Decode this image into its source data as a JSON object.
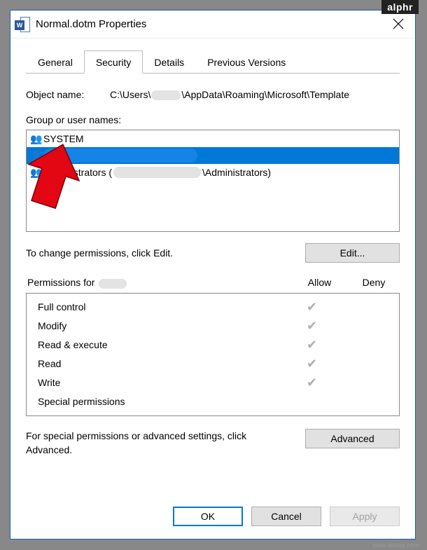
{
  "watermark": "alphr",
  "attribution": "www.deuag.com",
  "window_title": "Normal.dotm Properties",
  "tabs": [
    "General",
    "Security",
    "Details",
    "Previous Versions"
  ],
  "active_tab": "Security",
  "object": {
    "label": "Object name:",
    "path_prefix": "C:\\Users\\",
    "path_suffix": "\\AppData\\Roaming\\Microsoft\\Template"
  },
  "group_label": "Group or user names:",
  "users": {
    "system": "SYSTEM",
    "admins_prefix": "Administrators (",
    "admins_suffix": "\\Administrators)"
  },
  "edit_hint": "To change permissions, click Edit.",
  "edit_button": "Edit...",
  "perm_header": {
    "label_prefix": "Permissions for",
    "allow": "Allow",
    "deny": "Deny"
  },
  "permissions": [
    {
      "name": "Full control",
      "allow": true,
      "deny": false
    },
    {
      "name": "Modify",
      "allow": true,
      "deny": false
    },
    {
      "name": "Read & execute",
      "allow": true,
      "deny": false
    },
    {
      "name": "Read",
      "allow": true,
      "deny": false
    },
    {
      "name": "Write",
      "allow": true,
      "deny": false
    },
    {
      "name": "Special permissions",
      "allow": false,
      "deny": false
    }
  ],
  "adv_hint": "For special permissions or advanced settings, click Advanced.",
  "adv_button": "Advanced",
  "buttons": {
    "ok": "OK",
    "cancel": "Cancel",
    "apply": "Apply"
  }
}
